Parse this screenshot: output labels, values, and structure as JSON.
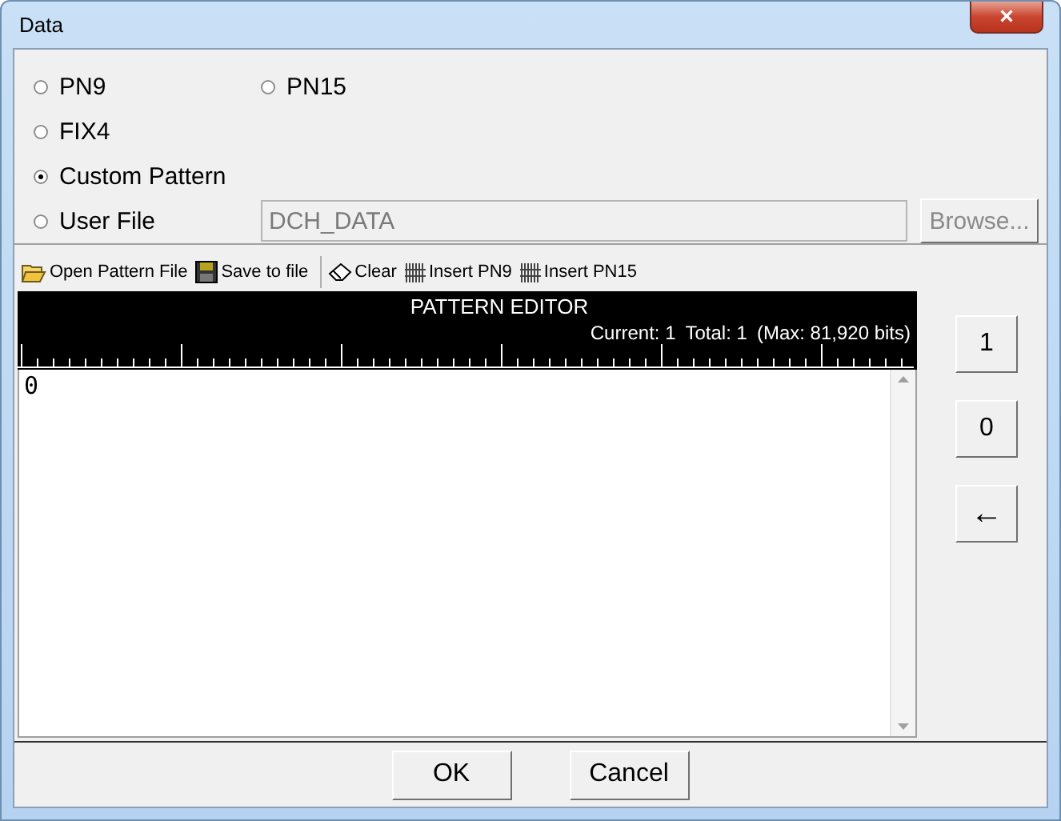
{
  "window": {
    "title": "Data",
    "close": "×"
  },
  "radio_rows": [
    [
      {
        "label": "PN9",
        "selected": false,
        "kind": "plain"
      },
      {
        "label": "PN15",
        "selected": false,
        "kind": "plain"
      }
    ],
    [
      {
        "label": "FIX4",
        "selected": false,
        "kind": "plain"
      }
    ],
    [
      {
        "label": "Custom Pattern",
        "selected": true,
        "kind": "plain"
      }
    ],
    [
      {
        "label": "User File",
        "selected": false,
        "kind": "file"
      }
    ]
  ],
  "user_file": {
    "value": "DCH_DATA",
    "disabled": true
  },
  "browse_button": {
    "label": "Browse...",
    "disabled": true
  },
  "toolbar": [
    {
      "label": "Open Pattern File",
      "kind": "open"
    },
    {
      "label": "Save to file",
      "kind": "save"
    },
    {
      "kind": "separator"
    },
    {
      "label": "Clear",
      "kind": "eraser"
    },
    {
      "label": "Insert PN9",
      "kind": "bits"
    },
    {
      "label": "Insert PN15",
      "kind": "bits"
    }
  ],
  "editor": {
    "title": "PATTERN EDITOR",
    "current": "Current: 1",
    "total": "Total: 1",
    "max": "(Max: 81,920 bits)",
    "content": "0"
  },
  "keypad": [
    "1",
    "0",
    "←"
  ],
  "buttons": [
    "OK",
    "Cancel"
  ]
}
